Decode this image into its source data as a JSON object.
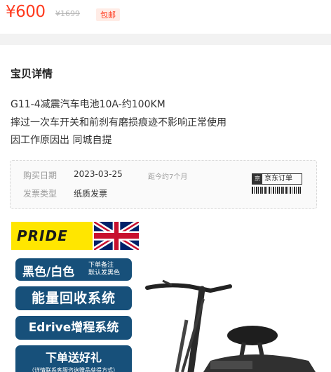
{
  "price": {
    "current": "¥600",
    "original": "¥1699",
    "tag": "包邮"
  },
  "detail": {
    "title": "宝贝详情",
    "lines": [
      "G11-4减震汽车电池10A-约100KM",
      "摔过一次车开关和前刹有磨损痕迹不影响正常使用",
      "因工作原因出 同城自提"
    ]
  },
  "purchase": {
    "date_label": "购买日期",
    "date_value": "2023-03-25",
    "date_ago": "距今约7个月",
    "invoice_label": "发票类型",
    "invoice_value": "纸质发票",
    "badge": "京东订单",
    "badge_icon": "京"
  },
  "photo": {
    "brand": "PRIDE",
    "pills": [
      {
        "main": "黑色/白色",
        "note1": "下单备注",
        "note2": "默认发黑色"
      },
      {
        "main": "能量回收系统"
      },
      {
        "main": "Edrive增程系统"
      },
      {
        "main": "下单送好礼",
        "note": "（详情联系客服咨询赠品获得方式）"
      }
    ]
  },
  "colors": {
    "price": "#ff3b1f",
    "pill": "#17507a",
    "brand_bg": "#ffe600"
  }
}
